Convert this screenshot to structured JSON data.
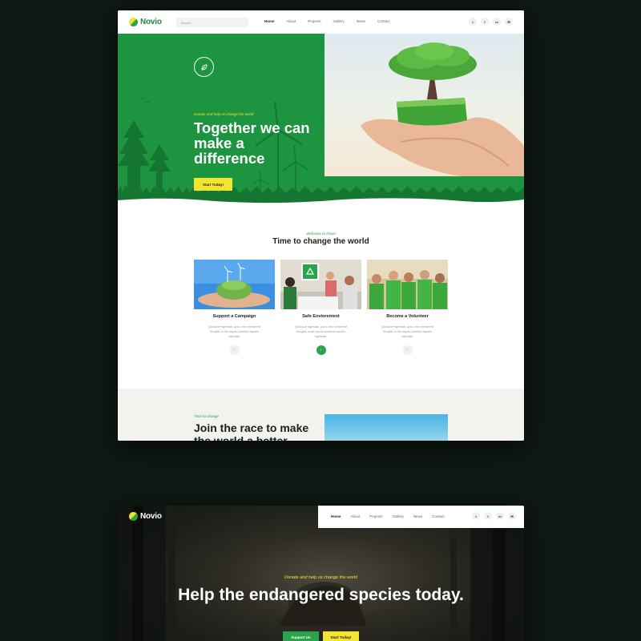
{
  "screen1": {
    "logo": "Novio",
    "search_placeholder": "Search",
    "nav": [
      "Home",
      "About",
      "Projects",
      "Gallery",
      "News",
      "Contact"
    ],
    "socials": [
      "t",
      "f",
      "in",
      "✉"
    ],
    "hero": {
      "kicker": "Donate and help us change the world",
      "title": "Together we can make a difference",
      "button": "Start Today!"
    },
    "welcome": {
      "kicker": "Welcome to Novio",
      "title": "Time to change the world"
    },
    "cards": [
      {
        "title": "Support a Campaign",
        "text": "Quisque egestas, justo nec hendrerit feugiat, nulla turpis porttitor sapien egestas.",
        "button": "›"
      },
      {
        "title": "Safe Enviorement",
        "text": "Quisque egestas, justo nec hendrerit feugiat, nulla turpis porttitor sapien egestas.",
        "button": "›"
      },
      {
        "title": "Become a Volunteer",
        "text": "Quisque egestas, justo nec hendrerit feugiat, nulla turpis porttitor sapien egestas.",
        "button": "›"
      }
    ],
    "race": {
      "kicker": "Time to change",
      "title": "Join the race to make the world a better"
    }
  },
  "screen2": {
    "logo": "Novio",
    "nav": [
      "Home",
      "About",
      "Projects",
      "Gallery",
      "News",
      "Contact"
    ],
    "socials": [
      "t",
      "f",
      "in",
      "✉"
    ],
    "kicker": "Donate and help us change the world",
    "title": "Help the endangered species today.",
    "support_button": "Support Us",
    "start_button": "Start Today!"
  },
  "colors": {
    "brand_green": "#1d9440",
    "accent_yellow": "#f2e431",
    "background": "#0f1812"
  }
}
